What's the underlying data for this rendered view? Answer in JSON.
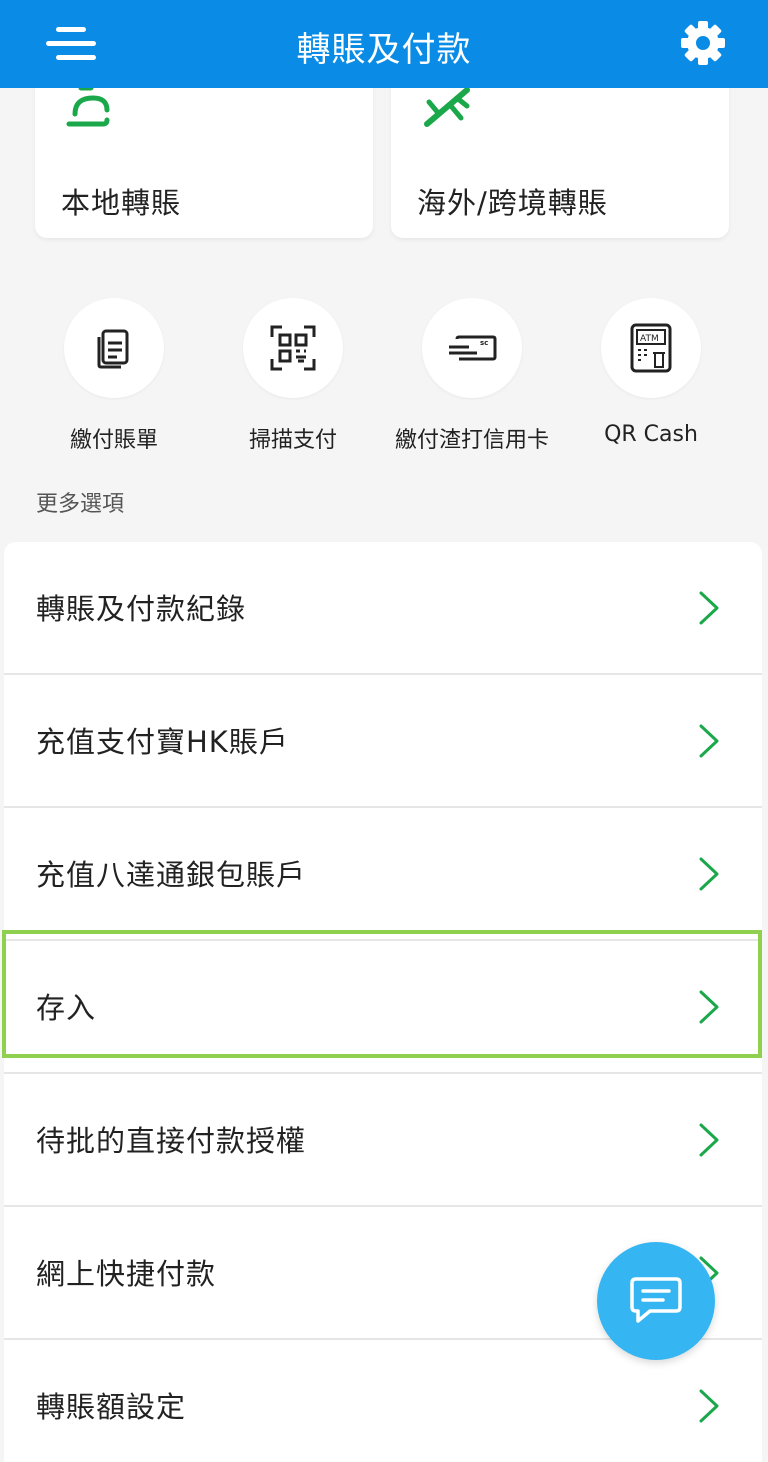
{
  "header": {
    "title": "轉賬及付款",
    "menu_icon": "hamburger-menu-icon",
    "settings_icon": "gear-icon",
    "bg_color": "#0a8ce6"
  },
  "cards": [
    {
      "label": "本地轉賬",
      "icon": "local-transfer-icon"
    },
    {
      "label": "海外/跨境轉賬",
      "icon": "airplane-icon"
    }
  ],
  "quick_actions": [
    {
      "label": "繳付賬單",
      "icon": "bill-document-icon"
    },
    {
      "label": "掃描支付",
      "icon": "qr-scan-icon"
    },
    {
      "label": "繳付渣打信用卡",
      "icon": "credit-card-icon"
    },
    {
      "label": "QR Cash",
      "icon": "atm-icon",
      "icon_text": "ATM"
    }
  ],
  "more_options": {
    "title": "更多選項",
    "items": [
      {
        "label": "轉賬及付款紀錄"
      },
      {
        "label": "充值支付寶HK賬戶"
      },
      {
        "label": "充值八達通銀包賬戶"
      },
      {
        "label": "存入",
        "highlighted": true
      },
      {
        "label": "待批的直接付款授權"
      },
      {
        "label": "網上快捷付款"
      },
      {
        "label": "轉賬額設定"
      }
    ]
  },
  "colors": {
    "accent_green": "#1aa84a",
    "highlight_border": "#8fd14f",
    "chat_fab": "#35b6f2"
  }
}
